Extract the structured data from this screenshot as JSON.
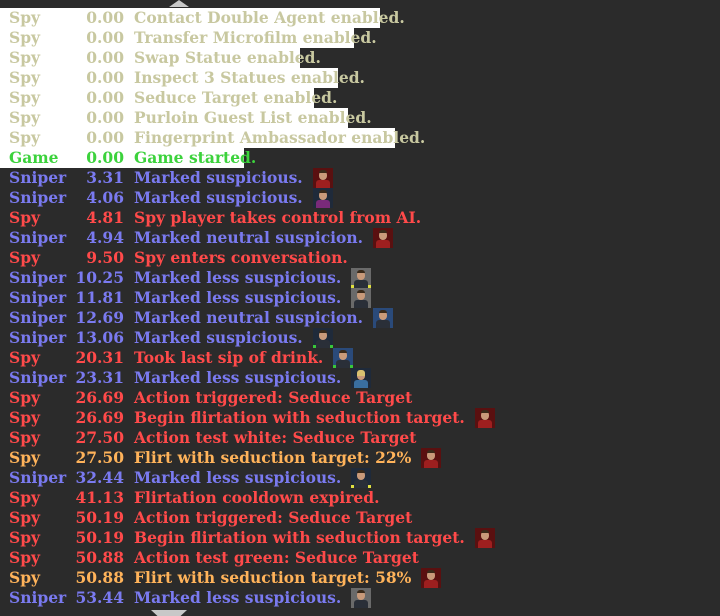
{
  "colors": {
    "spy": "#ff4a4a",
    "sniper": "#7a7af0",
    "game": "#3cd23c",
    "enabled": "#c8c8a0",
    "spy_light": "#ffb35a",
    "highlight_bg": "#ffffff",
    "background": "#2b2b2b"
  },
  "log": [
    {
      "actor": "Spy",
      "time": "0.00",
      "message": "Contact Double Agent enabled.",
      "style": "enabled",
      "highlight": true
    },
    {
      "actor": "Spy",
      "time": "0.00",
      "message": "Transfer Microfilm enabled.",
      "style": "enabled",
      "highlight": true
    },
    {
      "actor": "Spy",
      "time": "0.00",
      "message": "Swap Statue enabled.",
      "style": "enabled",
      "highlight": true
    },
    {
      "actor": "Spy",
      "time": "0.00",
      "message": "Inspect 3 Statues enabled.",
      "style": "enabled",
      "highlight": true
    },
    {
      "actor": "Spy",
      "time": "0.00",
      "message": "Seduce Target enabled.",
      "style": "enabled",
      "highlight": true
    },
    {
      "actor": "Spy",
      "time": "0.00",
      "message": "Purloin Guest List enabled.",
      "style": "enabled",
      "highlight": true
    },
    {
      "actor": "Spy",
      "time": "0.00",
      "message": "Fingerprint Ambassador enabled.",
      "style": "enabled",
      "highlight": true
    },
    {
      "actor": "Game",
      "time": "0.00",
      "message": "Game started.",
      "style": "game",
      "highlight": true
    },
    {
      "actor": "Sniper",
      "time": "3.31",
      "message": "Marked suspicious.",
      "style": "sniper",
      "portrait": "red-shirt"
    },
    {
      "actor": "Sniper",
      "time": "4.06",
      "message": "Marked suspicious.",
      "style": "sniper",
      "portrait": "purple-shirt"
    },
    {
      "actor": "Spy",
      "time": "4.81",
      "message": "Spy player takes control from AI.",
      "style": "spy"
    },
    {
      "actor": "Sniper",
      "time": "4.94",
      "message": "Marked neutral suspicion.",
      "style": "sniper",
      "portrait": "red-shirt"
    },
    {
      "actor": "Spy",
      "time": "9.50",
      "message": "Spy enters conversation.",
      "style": "spy"
    },
    {
      "actor": "Sniper",
      "time": "10.25",
      "message": "Marked less suspicious.",
      "style": "sniper",
      "portrait": "grey-bg yellow-ring"
    },
    {
      "actor": "Sniper",
      "time": "11.81",
      "message": "Marked less suspicious.",
      "style": "sniper",
      "portrait": "grey-bg"
    },
    {
      "actor": "Sniper",
      "time": "12.69",
      "message": "Marked neutral suspicion.",
      "style": "sniper",
      "portrait": "blue-bg"
    },
    {
      "actor": "Sniper",
      "time": "13.06",
      "message": "Marked suspicious.",
      "style": "sniper",
      "portrait": "green-ring"
    },
    {
      "actor": "Spy",
      "time": "20.31",
      "message": "Took last sip of drink.",
      "style": "spy",
      "portrait": "blue-bg green-ring"
    },
    {
      "actor": "Sniper",
      "time": "23.31",
      "message": "Marked less suspicious.",
      "style": "sniper",
      "portrait": "blonde"
    },
    {
      "actor": "Spy",
      "time": "26.69",
      "message": "Action triggered: Seduce Target",
      "style": "spy"
    },
    {
      "actor": "Spy",
      "time": "26.69",
      "message": "Begin flirtation with seduction target.",
      "style": "spy",
      "portrait": "red-shirt"
    },
    {
      "actor": "Spy",
      "time": "27.50",
      "message": "Action test white: Seduce Target",
      "style": "spy"
    },
    {
      "actor": "Spy",
      "time": "27.50",
      "message": "Flirt with seduction target: 22%",
      "style": "spy_light",
      "portrait": "red-shirt"
    },
    {
      "actor": "Sniper",
      "time": "32.44",
      "message": "Marked less suspicious.",
      "style": "sniper",
      "portrait": "yellow-ring"
    },
    {
      "actor": "Spy",
      "time": "41.13",
      "message": "Flirtation cooldown expired.",
      "style": "spy"
    },
    {
      "actor": "Spy",
      "time": "50.19",
      "message": "Action triggered: Seduce Target",
      "style": "spy"
    },
    {
      "actor": "Spy",
      "time": "50.19",
      "message": "Begin flirtation with seduction target.",
      "style": "spy",
      "portrait": "red-shirt"
    },
    {
      "actor": "Spy",
      "time": "50.88",
      "message": "Action test green: Seduce Target",
      "style": "spy"
    },
    {
      "actor": "Spy",
      "time": "50.88",
      "message": "Flirt with seduction target: 58%",
      "style": "spy_light",
      "portrait": "red-shirt"
    },
    {
      "actor": "Sniper",
      "time": "53.44",
      "message": "Marked less suspicious.",
      "style": "sniper",
      "portrait": "grey-bg"
    }
  ]
}
